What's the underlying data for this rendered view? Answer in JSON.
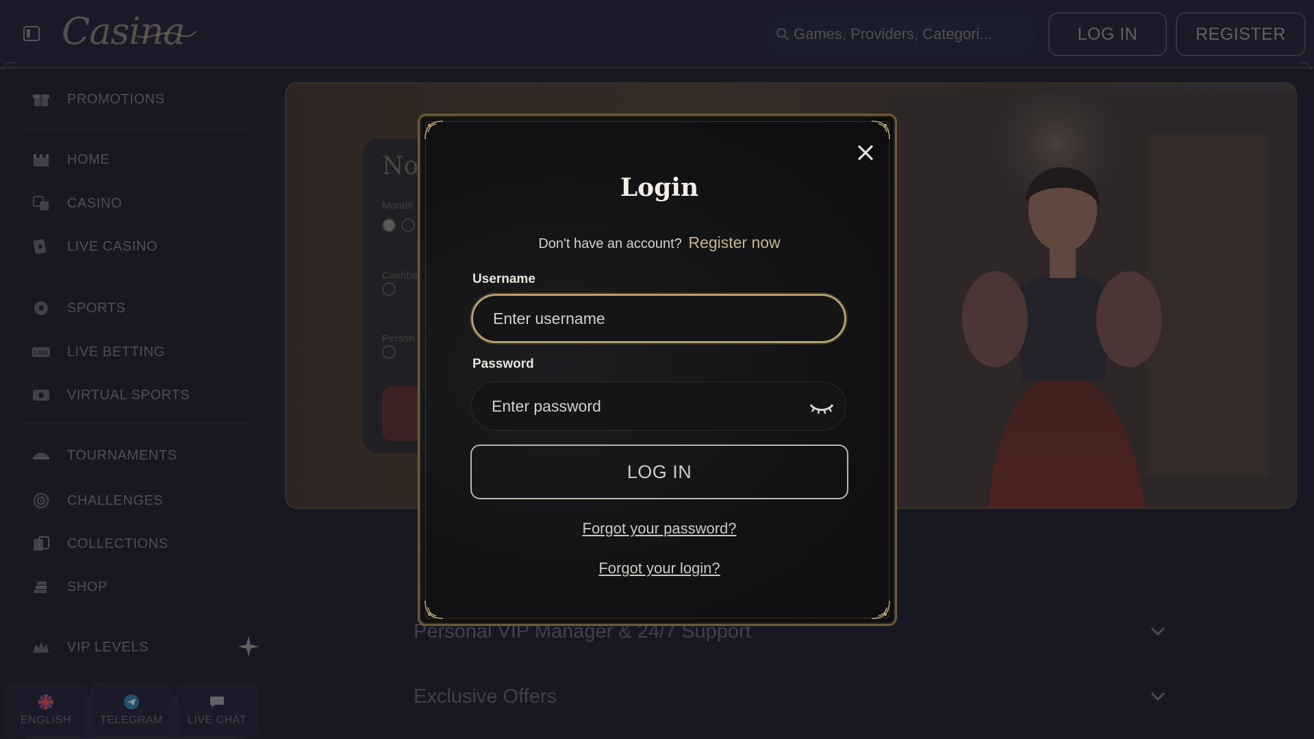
{
  "header": {
    "brand": "Casina",
    "search_placeholder": "Games, Providers, Categori...",
    "login_label": "LOG IN",
    "register_label": "REGISTER"
  },
  "sidebar": {
    "items": [
      {
        "label": "PROMOTIONS",
        "icon": "gift-icon"
      },
      {
        "label": "HOME",
        "icon": "home-icon"
      },
      {
        "label": "CASINO",
        "icon": "casino-icon"
      },
      {
        "label": "LIVE CASINO",
        "icon": "live-casino-icon"
      },
      {
        "label": "SPORTS",
        "icon": "sports-icon"
      },
      {
        "label": "LIVE BETTING",
        "icon": "live-betting-icon"
      },
      {
        "label": "VIRTUAL SPORTS",
        "icon": "virtual-sports-icon"
      },
      {
        "label": "TOURNAMENTS",
        "icon": "trophy-icon"
      },
      {
        "label": "CHALLENGES",
        "icon": "target-icon"
      },
      {
        "label": "COLLECTIONS",
        "icon": "collections-icon"
      },
      {
        "label": "SHOP",
        "icon": "shop-icon"
      },
      {
        "label": "VIP LEVELS",
        "icon": "vip-icon"
      }
    ],
    "bottom": [
      {
        "label": "ENGLISH",
        "icon": "uk-flag-icon"
      },
      {
        "label": "TELEGRAM",
        "icon": "telegram-icon"
      },
      {
        "label": "LIVE CHAT",
        "icon": "chat-icon"
      }
    ]
  },
  "banner": {
    "card_title": "Nov",
    "card_lines": [
      "Monthl",
      "Cashba",
      "Person"
    ]
  },
  "accordion": [
    "Personal VIP Manager & 24/7 Support",
    "Exclusive Offers"
  ],
  "modal": {
    "title": "Login",
    "no_account_text": "Don't have an account?",
    "register_link": "Register now",
    "username_label": "Username",
    "username_placeholder": "Enter username",
    "password_label": "Password",
    "password_placeholder": "Enter password",
    "submit_label": "LOG IN",
    "forgot_password": "Forgot your password?",
    "forgot_login": "Forgot your login?"
  },
  "colors": {
    "accent_gold": "#c9b58e",
    "modal_border": "#6e5b3a",
    "background": "#1c1d2b"
  }
}
